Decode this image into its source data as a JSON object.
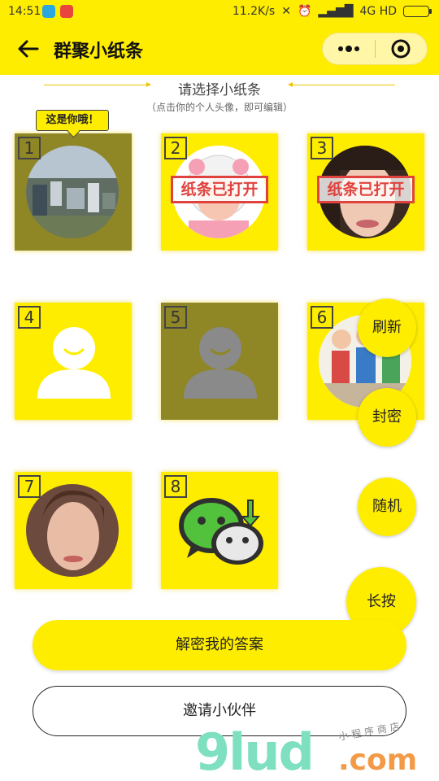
{
  "status": {
    "time": "14:51",
    "speed": "11.2K/s",
    "network": "4G HD"
  },
  "header": {
    "title": "群聚小纸条",
    "back_icon": "arrow-left-icon",
    "menu_icon": "more-dots-icon",
    "close_icon": "target-circle-icon"
  },
  "subtitle": {
    "title": "请选择小纸条",
    "hint": "（点击你的个人头像，即可编辑）"
  },
  "tooltip": "这是你哦！",
  "cards": [
    {
      "num": "1"
    },
    {
      "num": "2",
      "stamp": "纸条已打开"
    },
    {
      "num": "3",
      "stamp": "纸条已打开"
    },
    {
      "num": "4"
    },
    {
      "num": "5"
    },
    {
      "num": "6"
    },
    {
      "num": "7"
    },
    {
      "num": "8"
    }
  ],
  "fabs": {
    "refresh": "刷新",
    "seal": "封密",
    "random": "随机",
    "longpress": "长按"
  },
  "buttons": {
    "decrypt": "解密我的答案",
    "invite": "邀请小伙伴"
  },
  "watermark": {
    "logo": "9lud",
    "com": ".com",
    "small": "小程序商店"
  },
  "colors": {
    "brand_yellow": "#ffed00",
    "dim_card": "#8f8625",
    "stamp_red": "#e0423e"
  }
}
